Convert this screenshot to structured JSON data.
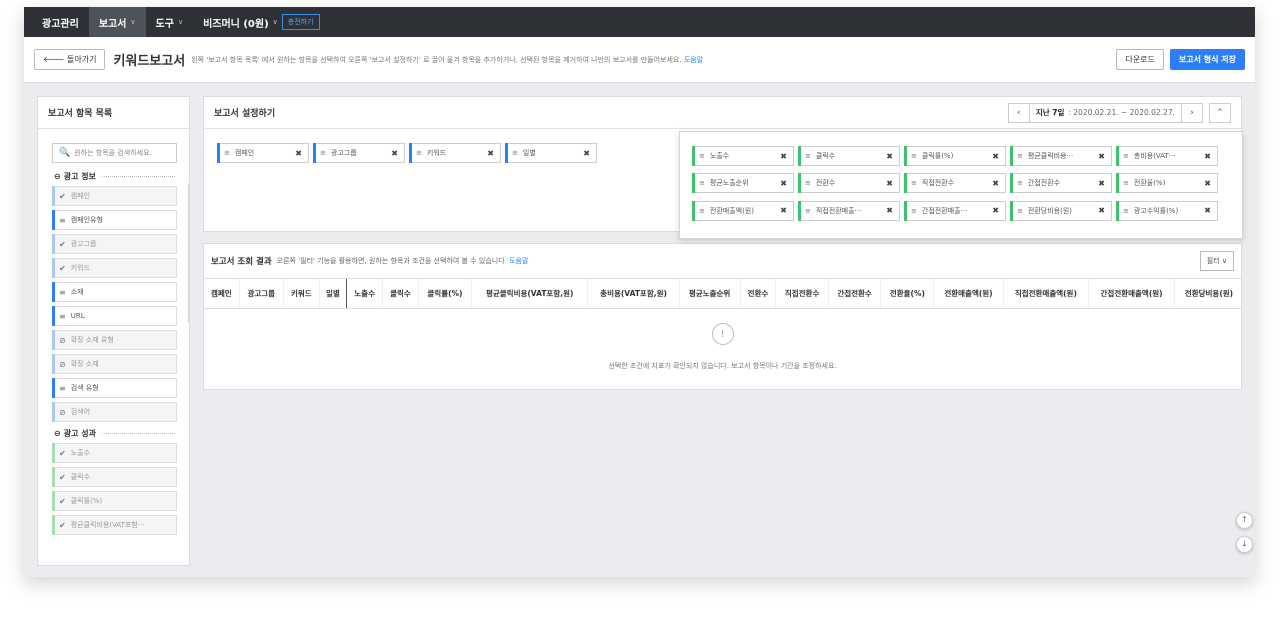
{
  "nav": {
    "items": [
      {
        "label": "광고관리",
        "active": false
      },
      {
        "label": "보고서",
        "active": true,
        "caret": "∨"
      },
      {
        "label": "도구",
        "active": false,
        "caret": "∨"
      },
      {
        "label": "비즈머니 (0원)",
        "active": false,
        "caret": "∨"
      }
    ],
    "charge_label": "충전하기"
  },
  "subheader": {
    "back_label": "돌아가기",
    "title": "키워드보고서",
    "description": "왼쪽 '보고서 항목 목록' 에서 원하는 항목을 선택하여 오른쪽 '보고서 설정하기' 로 끌어 옮겨 항목을 추가하거나, 선택된 항목을 제거하여 나만의 보고서를 만들어보세요.",
    "help_link": "도움말",
    "download_label": "다운로드",
    "save_label": "보고서 형식 저장"
  },
  "left_panel": {
    "title": "보고서 항목 목록",
    "search_placeholder": "원하는 항목을 검색하세요.",
    "section1": {
      "title": "광고 정보",
      "items": [
        {
          "label": "캠페인",
          "icon": "check-icon",
          "state": "added"
        },
        {
          "label": "캠페인유형",
          "icon": "drag-icon",
          "state": "available"
        },
        {
          "label": "광고그룹",
          "icon": "check-icon",
          "state": "added"
        },
        {
          "label": "키워드",
          "icon": "check-icon",
          "state": "added"
        },
        {
          "label": "소재",
          "icon": "drag-icon",
          "state": "available"
        },
        {
          "label": "URL",
          "icon": "drag-icon",
          "state": "available"
        },
        {
          "label": "확장 소재 유형",
          "icon": "disabled-icon",
          "state": "disabled"
        },
        {
          "label": "확장 소재",
          "icon": "disabled-icon",
          "state": "disabled"
        },
        {
          "label": "검색 유형",
          "icon": "drag-icon",
          "state": "available"
        },
        {
          "label": "검색어",
          "icon": "disabled-icon",
          "state": "disabled"
        }
      ]
    },
    "section2": {
      "title": "광고 성과",
      "items": [
        {
          "label": "노출수",
          "icon": "check-icon",
          "state": "added"
        },
        {
          "label": "클릭수",
          "icon": "check-icon",
          "state": "added"
        },
        {
          "label": "클릭률(%)",
          "icon": "check-icon",
          "state": "added"
        },
        {
          "label": "평균클릭비용(VAT포함···",
          "icon": "check-icon",
          "state": "added"
        }
      ]
    }
  },
  "settings_panel": {
    "title": "보고서 설정하기",
    "date_label": "지난 7일",
    "date_range": ": 2020.02.21. ~ 2020.02.27.",
    "dimension_chips": [
      "캠페인",
      "광고그룹",
      "키워드",
      "일별"
    ],
    "metric_chips": [
      "노출수",
      "클릭수",
      "클릭률(%)",
      "평균클릭비용···",
      "총비용(VAT···",
      "평균노출순위",
      "전환수",
      "직접전환수",
      "간접전환수",
      "전환율(%)",
      "전환매출액(원)",
      "직접전환매출···",
      "간접전환매출···",
      "전환당비용(원)",
      "광고수익률(%)"
    ]
  },
  "result_panel": {
    "title": "보고서 조회 결과",
    "description": "오른쪽 '필터' 기능을 활용하면, 원하는 항목과 조건을 선택하여 볼 수 있습니다.",
    "help_link": "도움말",
    "filter_label": "필터",
    "columns": [
      "캠페인",
      "광고그룹",
      "키워드",
      "일별",
      "노출수",
      "클릭수",
      "클릭률(%)",
      "평균클릭비용(VAT포함,원)",
      "총비용(VAT포함,원)",
      "평균노출순위",
      "전환수",
      "직접전환수",
      "간접전환수",
      "전환율(%)",
      "전환매출액(원)",
      "직접전환매출액(원)",
      "간접전환매출액(원)",
      "전환당비용(원)"
    ],
    "empty_icon": "!",
    "empty_message": "선택한 조건에 지표가 확인되지 않습니다. 보고서 항목이나 기간을 조정하세요."
  },
  "colors": {
    "accent": "#2d7ff9",
    "metric": "#3cc46b",
    "nav_bg": "#2e3236"
  }
}
